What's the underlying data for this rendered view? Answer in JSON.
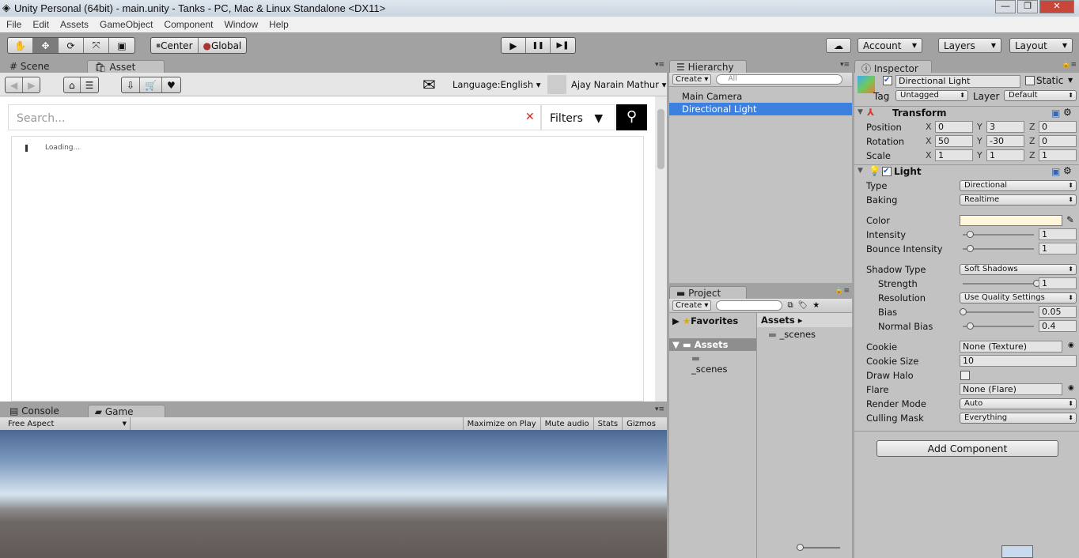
{
  "window": {
    "title": "Unity Personal (64bit) - main.unity - Tanks - PC, Mac & Linux Standalone <DX11>",
    "min": "—",
    "max": "❐",
    "close": "✕"
  },
  "menu": [
    "File",
    "Edit",
    "Assets",
    "GameObject",
    "Component",
    "Window",
    "Help"
  ],
  "toolbar": {
    "tools": [
      "hand",
      "move",
      "rotate",
      "scale",
      "rect"
    ],
    "active_tool": "move",
    "pivot": "Center",
    "space": "Global",
    "play": "▶",
    "pause": "❚❚",
    "step": "▶❚",
    "account": "Account",
    "layers": "Layers",
    "layout": "Layout"
  },
  "scene_panel": {
    "tabs": [
      "Scene",
      "Asset Store"
    ],
    "active_tab": "Asset Store",
    "language": "Language:English",
    "user": "Ajay Narain Mathur",
    "search_placeholder": "Search...",
    "filters": "Filters",
    "loading": "Loading..."
  },
  "game_panel": {
    "tabs": [
      "Console",
      "Game"
    ],
    "active_tab": "Game",
    "aspect": "Free Aspect",
    "buttons": [
      "Maximize on Play",
      "Mute audio",
      "Stats",
      "Gizmos"
    ]
  },
  "hierarchy": {
    "title": "Hierarchy",
    "create": "Create",
    "search_placeholder": "All",
    "items": [
      "Main Camera",
      "Directional Light"
    ],
    "selected": "Directional Light"
  },
  "project": {
    "title": "Project",
    "create": "Create",
    "favorites": "Favorites",
    "assets": "Assets",
    "tree_children": [
      "_scenes"
    ],
    "breadcrumb": "Assets",
    "files": [
      "_scenes"
    ]
  },
  "inspector": {
    "title": "Inspector",
    "object_name": "Directional Light",
    "active": true,
    "static_label": "Static",
    "static": false,
    "tag_label": "Tag",
    "tag": "Untagged",
    "layer_label": "Layer",
    "layer": "Default",
    "transform": {
      "title": "Transform",
      "rows": [
        {
          "label": "Position",
          "x": "0",
          "y": "3",
          "z": "0"
        },
        {
          "label": "Rotation",
          "x": "50",
          "y": "-30",
          "z": "0"
        },
        {
          "label": "Scale",
          "x": "1",
          "y": "1",
          "z": "1"
        }
      ]
    },
    "light": {
      "title": "Light",
      "enabled": true,
      "type_label": "Type",
      "type": "Directional",
      "baking_label": "Baking",
      "baking": "Realtime",
      "color_label": "Color",
      "color": "#fff6dc",
      "intensity_label": "Intensity",
      "intensity": "1",
      "bounce_label": "Bounce Intensity",
      "bounce": "1",
      "shadow_type_label": "Shadow Type",
      "shadow_type": "Soft Shadows",
      "strength_label": "Strength",
      "strength": "1",
      "resolution_label": "Resolution",
      "resolution": "Use Quality Settings",
      "bias_label": "Bias",
      "bias": "0.05",
      "normal_bias_label": "Normal Bias",
      "normal_bias": "0.4",
      "cookie_label": "Cookie",
      "cookie": "None (Texture)",
      "cookie_size_label": "Cookie Size",
      "cookie_size": "10",
      "draw_halo_label": "Draw Halo",
      "draw_halo": false,
      "flare_label": "Flare",
      "flare": "None (Flare)",
      "render_mode_label": "Render Mode",
      "render_mode": "Auto",
      "culling_mask_label": "Culling Mask",
      "culling_mask": "Everything"
    },
    "add_component": "Add Component"
  }
}
